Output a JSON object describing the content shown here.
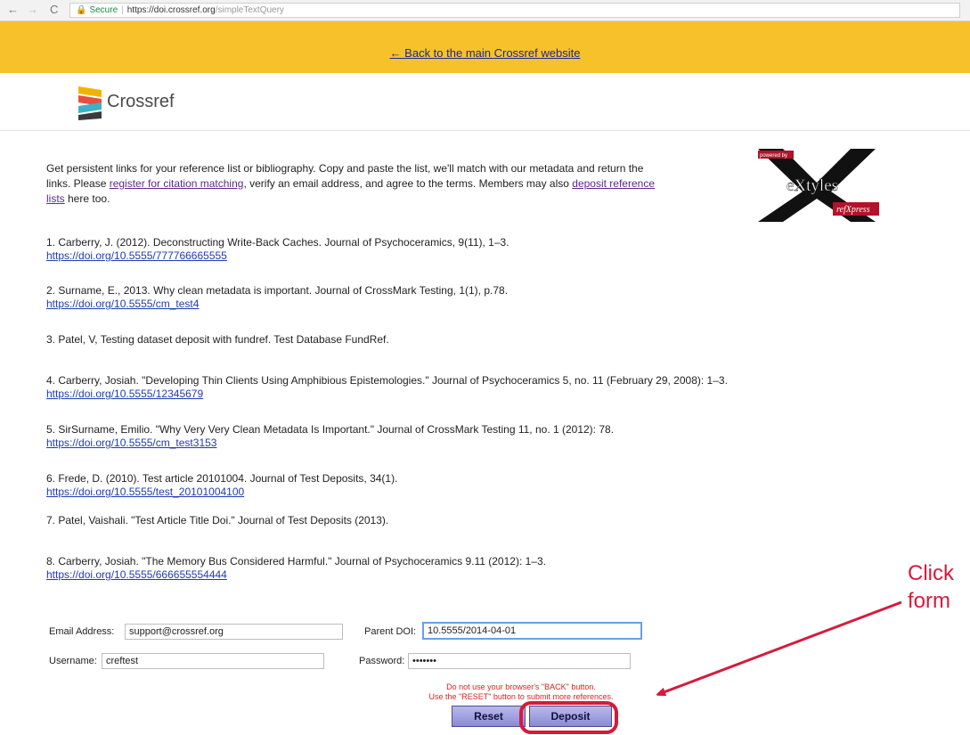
{
  "browser": {
    "back_icon": "back-arrow-icon",
    "forward_icon": "forward-arrow-icon",
    "reload_icon": "reload-icon",
    "lock_icon": "lock-icon",
    "secure_label": "Secure",
    "url_host": "https://doi.crossref.org",
    "url_path": "/simpleTextQuery"
  },
  "banner": {
    "back_link": "← Back to the main Crossref website",
    "color": "#f7c12b"
  },
  "header": {
    "logo_text": "Crossref"
  },
  "intro": {
    "text_1": "Get persistent links for your reference list or bibliography. Copy and paste the list, we'll match with our metadata and return the links. Please ",
    "link_1": "register for citation matching",
    "text_2": ", verify an email address, and agree to the terms. Members may also ",
    "link_2": "deposit reference lists",
    "text_3": " here too."
  },
  "partner_logo": {
    "top_text": "powered by",
    "main_text": "eXtyles",
    "sub_text": "refXpress"
  },
  "references": [
    {
      "citation": "1. Carberry, J. (2012). Deconstructing Write-Back Caches. Journal of Psychoceramics, 9(11), 1–3.",
      "doi": "https://doi.org/10.5555/777766665555"
    },
    {
      "citation": "2. Surname, E., 2013. Why clean metadata is important. Journal of CrossMark Testing, 1(1), p.78.",
      "doi": "https://doi.org/10.5555/cm_test4"
    },
    {
      "citation": "3. Patel, V, Testing dataset deposit with fundref. Test Database FundRef.",
      "doi": ""
    },
    {
      "citation": "4. Carberry, Josiah. \"Developing Thin Clients Using Amphibious Epistemologies.\" Journal of Psychoceramics 5, no. 11 (February 29, 2008): 1–3.",
      "doi": "https://doi.org/10.5555/12345679"
    },
    {
      "citation": "5. SirSurname, Emilio. \"Why Very Very Clean Metadata Is Important.\" Journal of CrossMark Testing 11, no. 1 (2012): 78.",
      "doi": "https://doi.org/10.5555/cm_test3153"
    },
    {
      "citation": "6. Frede, D. (2010). Test article 20101004. Journal of Test Deposits, 34(1).",
      "doi": "https://doi.org/10.5555/test_20101004100"
    },
    {
      "citation": "7. Patel, Vaishali. \"Test Article Title Doi.\" Journal of Test Deposits (2013).",
      "doi": ""
    },
    {
      "citation": "8. Carberry, Josiah. \"The Memory Bus Considered Harmful.\" Journal of Psychoceramics 9.11 (2012): 1–3.",
      "doi": "https://doi.org/10.5555/666655554444"
    }
  ],
  "form": {
    "email_label": "Email Address:",
    "email_value": "support@crossref.org",
    "parent_doi_label": "Parent DOI:",
    "parent_doi_value": "10.5555/2014-04-01",
    "username_label": "Username:",
    "username_value": "creftest",
    "password_label": "Password:",
    "password_value": "•••••••",
    "warning_line_1": "Do not use your browser's \"BACK\" button.",
    "warning_line_2": "Use the \"RESET\" button to submit more references.",
    "reset_label": "Reset",
    "deposit_label": "Deposit"
  },
  "annotation": {
    "line_1": "Click",
    "line_2": "form",
    "color": "#d61a3c"
  }
}
